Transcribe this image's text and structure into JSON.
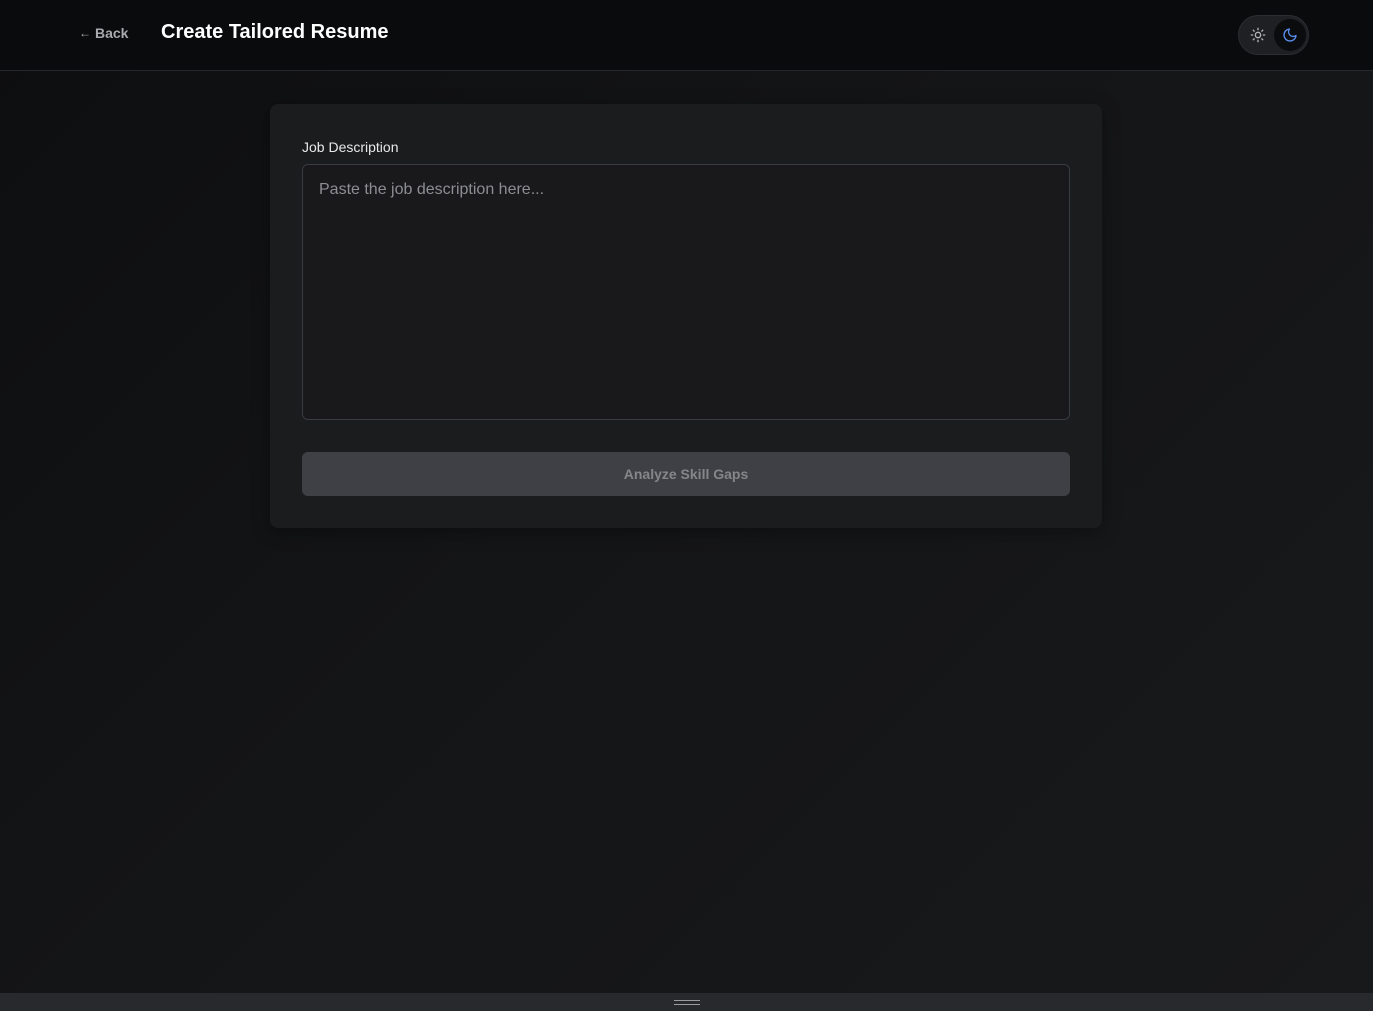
{
  "header": {
    "back_arrow": "←",
    "back_label": "Back",
    "title": "Create Tailored Resume",
    "theme_toggle": {
      "options": [
        "sun-icon",
        "moon-icon"
      ],
      "selected": "dark",
      "accent_color": "#5b8def"
    }
  },
  "form": {
    "job_description_label": "Job Description",
    "job_description_value": "",
    "job_description_placeholder": "Paste the job description here...",
    "submit_label": "Analyze Skill Gaps",
    "submit_disabled": true
  },
  "bottom_panel": {
    "handle_icon": "drag-handle-icon"
  }
}
